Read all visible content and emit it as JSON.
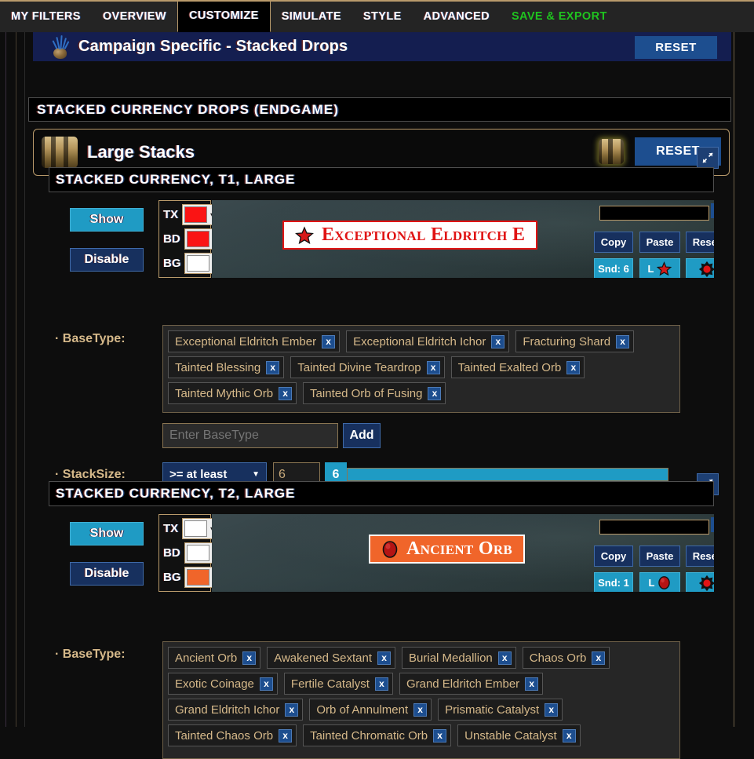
{
  "nav": {
    "tabs": [
      {
        "label": "MY FILTERS",
        "active": false
      },
      {
        "label": "OVERVIEW",
        "active": false
      },
      {
        "label": "CUSTOMIZE",
        "active": true
      },
      {
        "label": "SIMULATE",
        "active": false
      },
      {
        "label": "STYLE",
        "active": false
      },
      {
        "label": "ADVANCED",
        "active": false
      },
      {
        "label": "SAVE & EXPORT",
        "active": false,
        "accent": "#1fc41f"
      }
    ]
  },
  "banner": {
    "title": "Campaign Specific - Stacked Drops",
    "reset_label": "RESET",
    "icon": "seaweed-rock-icon",
    "bg_color": "#141e50"
  },
  "section_header": {
    "title": "STACKED CURRENCY DROPS (ENDGAME)"
  },
  "group": {
    "title": "Large Stacks",
    "icon": "stacked-masks-icon",
    "badge_icon": "stacked-masks-icon",
    "reset_label": "RESET"
  },
  "rules": [
    {
      "title": "STACKED CURRENCY, T1, LARGE",
      "collapse_icon": "collapse-icon",
      "show_label": "Show",
      "disable_label": "Disable",
      "colors": [
        {
          "label": "TX",
          "value": "#fa1414",
          "enabled": true
        },
        {
          "label": "BD",
          "value": "#fa1414",
          "enabled": true
        },
        {
          "label": "BG",
          "value": "#ffffff",
          "enabled": true
        }
      ],
      "preview": {
        "item_text": "Exceptional Eldritch E",
        "text_color": "#e01414",
        "bg_color": "#ffffff",
        "border_color": "#e01414",
        "icon": "red-star-icon",
        "font_size_value": "45"
      },
      "buttons": {
        "copy": "Copy",
        "paste": "Paste",
        "reset": "Reset",
        "sound": "Snd: 6",
        "minimap": "L",
        "minimap_icon": "red-star-icon",
        "beam_icon": "red-beam-icon"
      },
      "basetype": {
        "label": "BaseType:",
        "tags": [
          "Exceptional Eldritch Ember",
          "Exceptional Eldritch Ichor",
          "Fracturing Shard",
          "Tainted Blessing",
          "Tainted Divine Teardrop",
          "Tainted Exalted Orb",
          "Tainted Mythic Orb",
          "Tainted Orb of Fusing"
        ],
        "remove_label": "x",
        "input_placeholder": "Enter BaseType",
        "input_value": "",
        "add_label": "Add"
      },
      "stacksize": {
        "label": "StackSize:",
        "operator": ">= at least",
        "value": "6",
        "chip": "6",
        "slider_fill_percent": 100
      }
    },
    {
      "title": "STACKED CURRENCY, T2, LARGE",
      "collapse_icon": "collapse-icon",
      "show_label": "Show",
      "disable_label": "Disable",
      "colors": [
        {
          "label": "TX",
          "value": "#ffffff",
          "enabled": true
        },
        {
          "label": "BD",
          "value": "#ffffff",
          "enabled": true
        },
        {
          "label": "BG",
          "value": "#f0652a",
          "enabled": true
        }
      ],
      "preview": {
        "item_text": "Ancient Orb",
        "text_color": "#ffffff",
        "bg_color": "#f0652a",
        "border_color": "#ffffff",
        "icon": "red-orb-icon",
        "font_size_value": "45"
      },
      "buttons": {
        "copy": "Copy",
        "paste": "Paste",
        "reset": "Reset",
        "sound": "Snd: 1",
        "minimap": "L",
        "minimap_icon": "red-orb-icon",
        "beam_icon": "red-beam-icon"
      },
      "basetype": {
        "label": "BaseType:",
        "tags": [
          "Ancient Orb",
          "Awakened Sextant",
          "Burial Medallion",
          "Chaos Orb",
          "Exotic Coinage",
          "Fertile Catalyst",
          "Grand Eldritch Ember",
          "Grand Eldritch Ichor",
          "Orb of Annulment",
          "Prismatic Catalyst",
          "Tainted Chaos Orb",
          "Tainted Chromatic Orb",
          "Unstable Catalyst"
        ],
        "remove_label": "x"
      }
    }
  ],
  "theme": {
    "accent_blue": "#1d4e8f",
    "accent_cyan": "#1f9bc4",
    "gold_border": "#b99a6b",
    "tag_text": "#d6b98a",
    "page_bg": "#0d0d0d"
  }
}
